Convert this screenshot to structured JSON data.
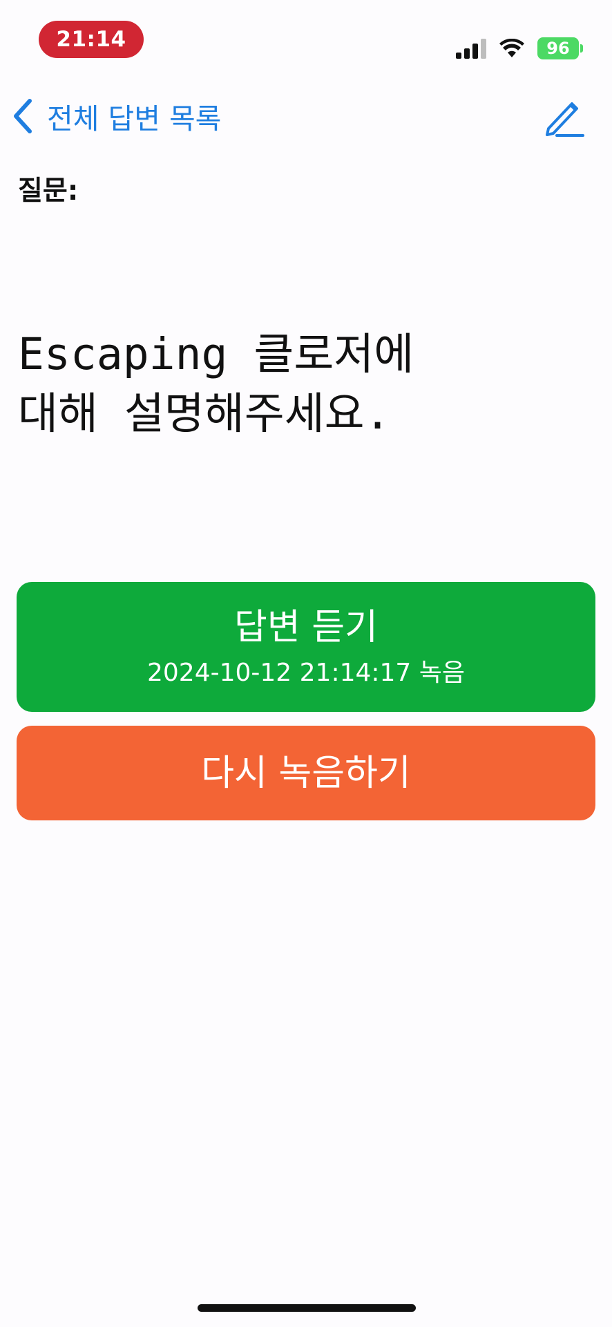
{
  "status_bar": {
    "time": "21:14",
    "battery_level": "96",
    "signal_icon": "cellular-signal-icon",
    "wifi_icon": "wifi-icon",
    "time_pill_color": "#d12633",
    "battery_color": "#4cd964"
  },
  "nav": {
    "back_label": "전체 답변 목록",
    "back_icon": "chevron-left-icon",
    "edit_icon": "pencil-icon",
    "accent_color": "#1f7ee0"
  },
  "question": {
    "label": "질문:",
    "text": "Escaping 클로저에\n대해 설명해주세요."
  },
  "buttons": {
    "listen": {
      "title": "답변 듣기",
      "subtitle": "2024-10-12 21:14:17 녹음",
      "color": "#0eaa3b"
    },
    "rerecord": {
      "title": "다시 녹음하기",
      "color": "#f36435"
    }
  }
}
